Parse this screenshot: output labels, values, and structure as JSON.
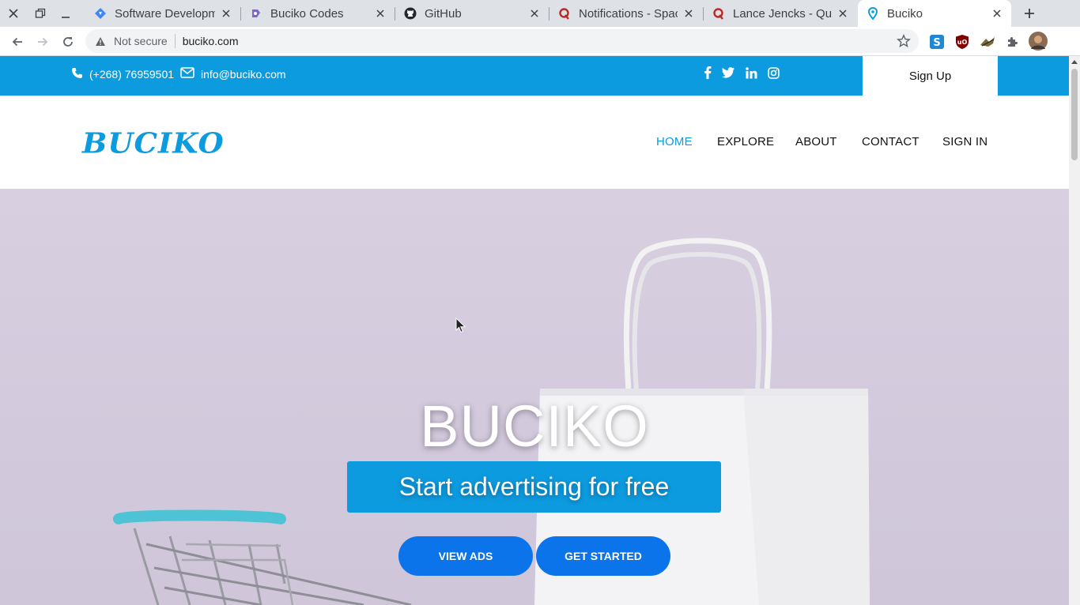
{
  "browser": {
    "tabs": [
      {
        "title": "Software Developm",
        "icon": "google-sites-icon",
        "active": false
      },
      {
        "title": "Buciko Codes",
        "icon": "purple-app-icon",
        "active": false
      },
      {
        "title": "GitHub",
        "icon": "github-icon",
        "active": false
      },
      {
        "title": "Notifications - Spac",
        "icon": "quora-icon",
        "active": false
      },
      {
        "title": "Lance Jencks - Quo",
        "icon": "quora-icon",
        "active": false
      },
      {
        "title": "Buciko",
        "icon": "location-pin-icon",
        "active": true
      }
    ],
    "address": {
      "security_label": "Not secure",
      "url": "buciko.com"
    },
    "extensions": [
      "skype-icon",
      "ublock-icon",
      "ext-icon",
      "puzzle-icon",
      "profile-avatar"
    ]
  },
  "site": {
    "topbar": {
      "phone": "(+268) 76959501",
      "email": "info@buciko.com",
      "social": [
        "facebook-icon",
        "twitter-icon",
        "linkedin-icon",
        "instagram-icon"
      ],
      "signup_label": "Sign Up"
    },
    "header": {
      "logo": "BUCIKO",
      "nav": [
        {
          "label": "HOME",
          "active": true
        },
        {
          "label": "EXPLORE",
          "active": false
        },
        {
          "label": "ABOUT",
          "active": false
        },
        {
          "label": "CONTACT",
          "active": false
        },
        {
          "label": "SIGN IN",
          "active": false
        }
      ]
    },
    "hero": {
      "title": "BUCIKO",
      "tagline": "Start advertising for free",
      "buttons": [
        "VIEW ADS",
        "GET STARTED"
      ]
    }
  },
  "colors": {
    "brand_blue": "#0d9be0",
    "button_blue": "#0b74ea",
    "hero_bg": "#d4cbde"
  }
}
